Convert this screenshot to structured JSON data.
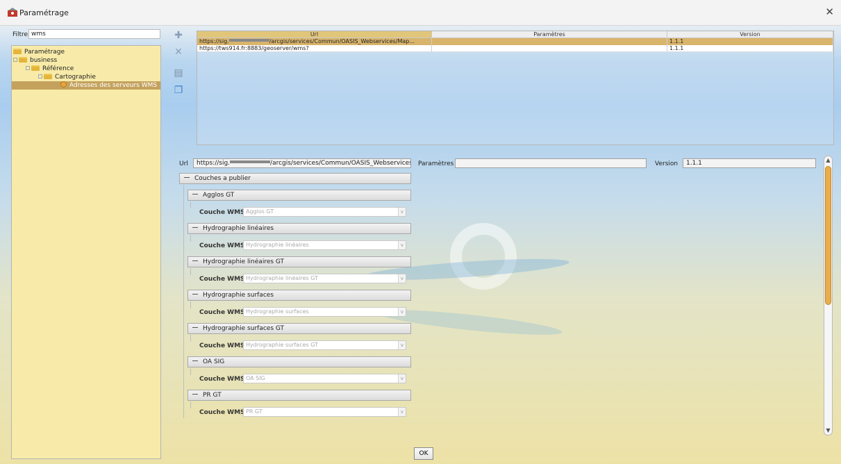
{
  "window": {
    "title": "Paramétrage",
    "close_icon": "close-icon"
  },
  "filter": {
    "label": "Filtrer",
    "value": "wms"
  },
  "tree": {
    "root": "Paramétrage",
    "business": "business",
    "reference": "Référence",
    "cartographie": "Cartographie",
    "selected_leaf": "Adresses des serveurs WMS"
  },
  "toolbar": {
    "add_icon": "plus-icon",
    "delete_icon": "x-icon",
    "stack_icon": "stack-icon",
    "copy_icon": "copy-icon"
  },
  "grid": {
    "columns": [
      "Url",
      "Paramètres",
      "Version"
    ],
    "rows": [
      {
        "url": "https://sig.              /arcgis/services/Commun/OASIS_Webservices/Map...",
        "params": "",
        "version": "1.1.1"
      },
      {
        "url": "https://tws914.fr:8883/geoserver/wms?",
        "params": "",
        "version": "1.1.1"
      }
    ]
  },
  "detail": {
    "url_label": "Url",
    "url_prefix": "https://sig.",
    "url_suffix": "/arcgis/services/Commun/OASIS_Webservices",
    "params_label": "Paramètres",
    "params_value": "",
    "version_label": "Version",
    "version_value": "1.1.1"
  },
  "layers_section": "Couches a publier",
  "layers": [
    {
      "title": "Agglos GT",
      "label": "Couche WMS",
      "value": "Agglos GT"
    },
    {
      "title": "Hydrographie linéaires",
      "label": "Couche WMS",
      "value": "Hydrographie linéaires"
    },
    {
      "title": "Hydrographie linéaires GT",
      "label": "Couche WMS",
      "value": "Hydrographie linéaires GT"
    },
    {
      "title": "Hydrographie surfaces",
      "label": "Couche WMS",
      "value": "Hydrographie surfaces"
    },
    {
      "title": "Hydrographie surfaces GT",
      "label": "Couche WMS",
      "value": "Hydrographie surfaces GT"
    },
    {
      "title": "OA SIG",
      "label": "Couche WMS",
      "value": "OA SIG"
    },
    {
      "title": "PR GT",
      "label": "Couche WMS",
      "value": "PR GT"
    }
  ],
  "ok_label": "OK",
  "colors": {
    "tree_bg": "#f8eba9",
    "selection": "#c4a25e",
    "scroll_thumb": "#e8ad4c"
  }
}
